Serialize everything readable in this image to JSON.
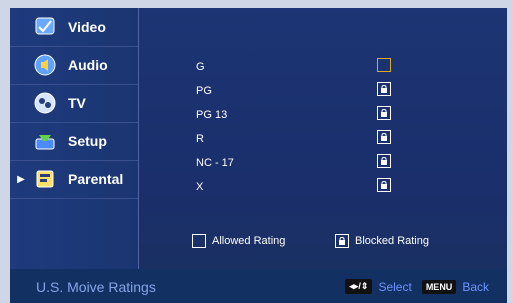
{
  "sidebar": {
    "items": [
      {
        "label": "Video",
        "icon": "video-icon",
        "active": false
      },
      {
        "label": "Audio",
        "icon": "audio-icon",
        "active": false
      },
      {
        "label": "TV",
        "icon": "tv-icon",
        "active": false
      },
      {
        "label": "Setup",
        "icon": "setup-icon",
        "active": false
      },
      {
        "label": "Parental",
        "icon": "parental-icon",
        "active": true
      }
    ]
  },
  "ratings": [
    {
      "name": "G",
      "state": "allowed"
    },
    {
      "name": "PG",
      "state": "blocked"
    },
    {
      "name": "PG 13",
      "state": "blocked"
    },
    {
      "name": "R",
      "state": "blocked"
    },
    {
      "name": "NC - 17",
      "state": "blocked"
    },
    {
      "name": "X",
      "state": "blocked"
    }
  ],
  "legend": {
    "allowed_label": "Allowed Rating",
    "blocked_label": "Blocked Rating"
  },
  "status": {
    "title": "U.S. Moive Ratings",
    "select_key": "◂▸/⇕",
    "select_label": "Select",
    "back_key": "MENU",
    "back_label": "Back"
  },
  "colors": {
    "allowed_outline": "#d7aa2b",
    "text": "#ffffff",
    "status_title": "#86a5e8",
    "status_hint": "#6f94ff"
  }
}
